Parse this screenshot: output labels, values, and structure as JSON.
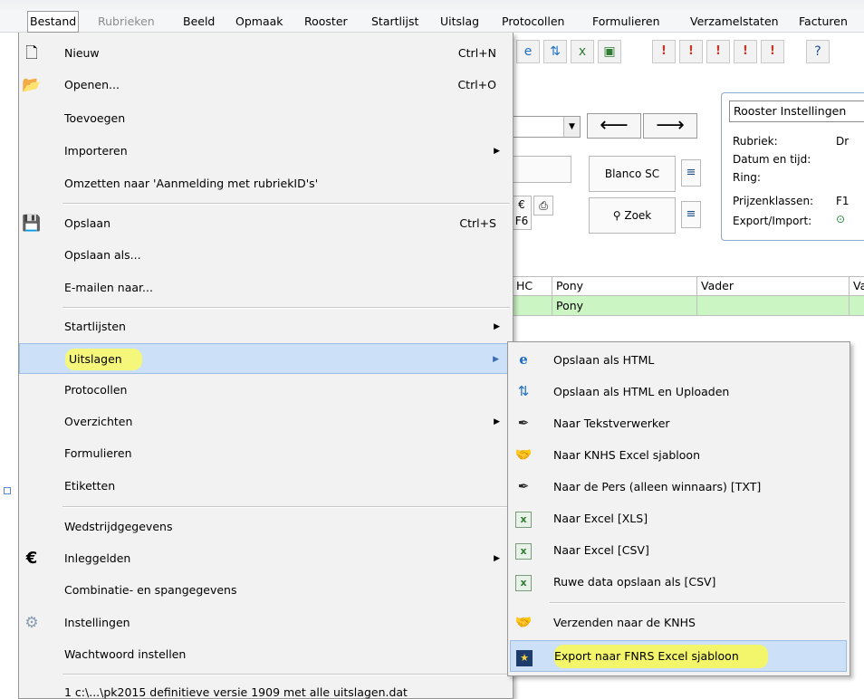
{
  "menubar": {
    "items": [
      {
        "label": "Bestand",
        "state": "open"
      },
      {
        "label": "Rubrieken",
        "state": "disabled"
      },
      {
        "label": "Beeld"
      },
      {
        "label": "Opmaak"
      },
      {
        "label": "Rooster"
      },
      {
        "label": "Startlijst"
      },
      {
        "label": "Uitslag"
      },
      {
        "label": "Protocollen"
      },
      {
        "label": "Formulieren"
      },
      {
        "label": "Verzamelstaten"
      },
      {
        "label": "Facturen"
      }
    ]
  },
  "file_menu": {
    "items": [
      {
        "label": "Nieuw",
        "shortcut": "Ctrl+N",
        "icon": "new-document-icon"
      },
      {
        "label": "Openen...",
        "shortcut": "Ctrl+O",
        "icon": "open-folder-icon"
      },
      {
        "label": "Toevoegen"
      },
      {
        "label": "Importeren",
        "submenu": true
      },
      {
        "label": "Omzetten naar 'Aanmelding met rubriekID's'"
      },
      {
        "label": "Opslaan",
        "shortcut": "Ctrl+S",
        "icon": "save-disk-icon"
      },
      {
        "label": "Opslaan als..."
      },
      {
        "label": "E-mailen naar..."
      },
      {
        "label": "Startlijsten",
        "submenu": true
      },
      {
        "label": "Uitslagen",
        "submenu": true,
        "highlighted": true
      },
      {
        "label": "Protocollen"
      },
      {
        "label": "Overzichten",
        "submenu": true
      },
      {
        "label": "Formulieren"
      },
      {
        "label": "Etiketten"
      },
      {
        "label": "Wedstrijdgegevens"
      },
      {
        "label": "Inleggelden",
        "submenu": true,
        "icon": "euro-icon"
      },
      {
        "label": "Combinatie- en spangegevens"
      },
      {
        "label": "Instellingen",
        "icon": "gear-icon"
      },
      {
        "label": "Wachtwoord instellen"
      },
      {
        "label": "1 c:\\...\\pk2015 definitieve versie 1909 met alle uitslagen.dat"
      }
    ]
  },
  "submenu_uitslagen": {
    "items": [
      {
        "label": "Opslaan als HTML",
        "icon": "internet-explorer-icon"
      },
      {
        "label": "Opslaan als HTML en Uploaden",
        "icon": "upload-icon"
      },
      {
        "label": "Naar Tekstverwerker",
        "icon": "pen-icon"
      },
      {
        "label": "Naar KNHS Excel sjabloon",
        "icon": "handshake-icon"
      },
      {
        "label": "Naar de Pers (alleen winnaars) [TXT]",
        "icon": "pen-icon"
      },
      {
        "label": "Naar Excel [XLS]",
        "icon": "excel-icon"
      },
      {
        "label": "Naar Excel [CSV]",
        "icon": "excel-icon"
      },
      {
        "label": "Ruwe data opslaan als [CSV]",
        "icon": "excel-icon"
      },
      {
        "label": "Verzenden naar de KNHS",
        "icon": "handshake-icon"
      },
      {
        "label": "Export naar FNRS Excel sjabloon",
        "icon": "fnrs-icon",
        "highlighted": true
      }
    ]
  },
  "background": {
    "settings_panel": {
      "title": "Rooster Instellingen",
      "rows": [
        {
          "label": "Rubriek:",
          "value": "Dr"
        },
        {
          "label": "Datum en tijd:",
          "value": ""
        },
        {
          "label": "Ring:",
          "value": ""
        },
        {
          "label": "Prijzenklassen:",
          "value": "F1"
        },
        {
          "label": "Export/Import:",
          "value": "⊙"
        }
      ]
    },
    "buttons": {
      "blanco_sc": "Blanco SC",
      "zoek": "Zoek",
      "f6": "F6",
      "euro": "€"
    },
    "grid": {
      "headers": [
        "HC",
        "Pony",
        "Vader",
        "Va"
      ],
      "rows": [
        [
          "",
          "Pony",
          "",
          ""
        ]
      ]
    }
  },
  "colors": {
    "menu_bg": "#f2f2f2",
    "highlight_bg": "#cce0f7",
    "marker_yellow": "#f5f77a",
    "grid_row_green": "#ccf5c4"
  }
}
